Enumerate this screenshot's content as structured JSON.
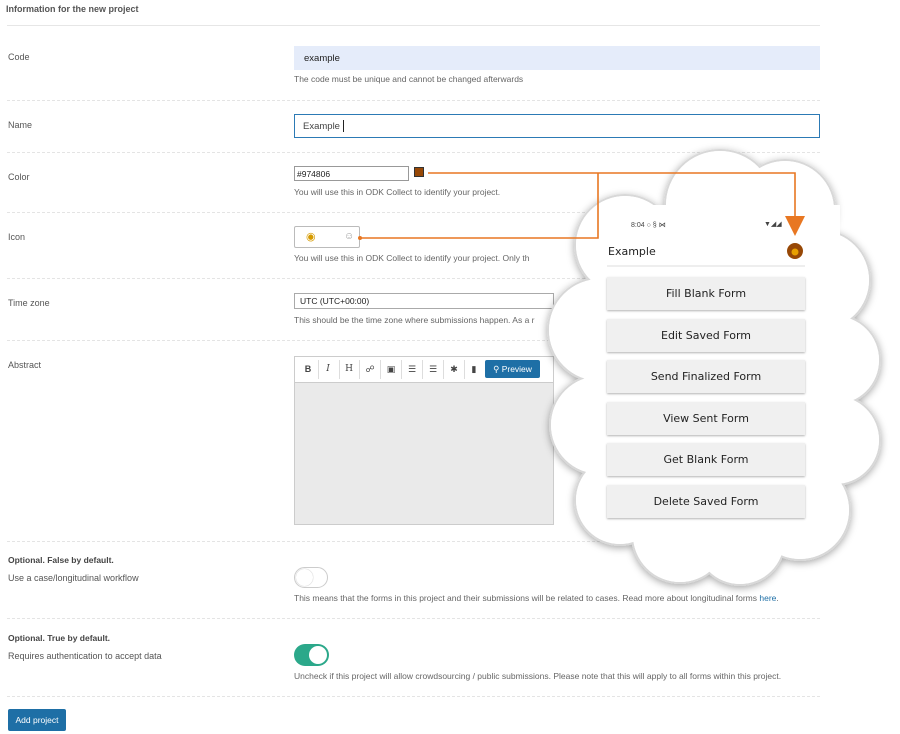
{
  "form": {
    "section_title": "Information for the new project",
    "code": {
      "label": "Code",
      "value": "example",
      "help": "The code must be unique and cannot be changed afterwards"
    },
    "name": {
      "label": "Name",
      "value": "Example"
    },
    "color": {
      "label": "Color",
      "value": "#974806",
      "help": "You will use this in ODK Collect to identify your project.",
      "swatch": "#974806"
    },
    "icon": {
      "label": "Icon",
      "help": "You will use this in ODK Collect to identify your project. Only th",
      "selected_icon": "medal-icon"
    },
    "timezone": {
      "label": "Time zone",
      "value": "UTC (UTC+00:00)",
      "help": "This should be the time zone where submissions happen. As a r"
    },
    "abstract": {
      "label": "Abstract",
      "toolbar": {
        "bold": "B",
        "italic": "I",
        "heading": "H",
        "preview_label": "Preview"
      }
    },
    "case_workflow": {
      "title": "Optional. False by default.",
      "label": "Use a case/longitudinal workflow",
      "help": "This means that the forms in this project and their submissions will be related to cases. Read more about longitudinal forms",
      "link": "here",
      "checked": false
    },
    "auth": {
      "title": "Optional. True by default.",
      "label": "Requires authentication to accept data",
      "help": "Uncheck if this project will allow crowdsourcing / public submissions. Please note that this will apply to all forms within this project.",
      "checked": true
    },
    "submit_label": "Add project"
  },
  "phone_preview": {
    "status_time": "8:04",
    "title": "Example",
    "buttons": [
      "Fill Blank Form",
      "Edit Saved Form",
      "Send Finalized Form",
      "View Sent Form",
      "Get Blank Form",
      "Delete Saved Form"
    ]
  },
  "colors": {
    "accent": "#1e6fa6",
    "toggle_on": "#2ba88a",
    "arrow": "#e87722",
    "project_color": "#974806"
  }
}
